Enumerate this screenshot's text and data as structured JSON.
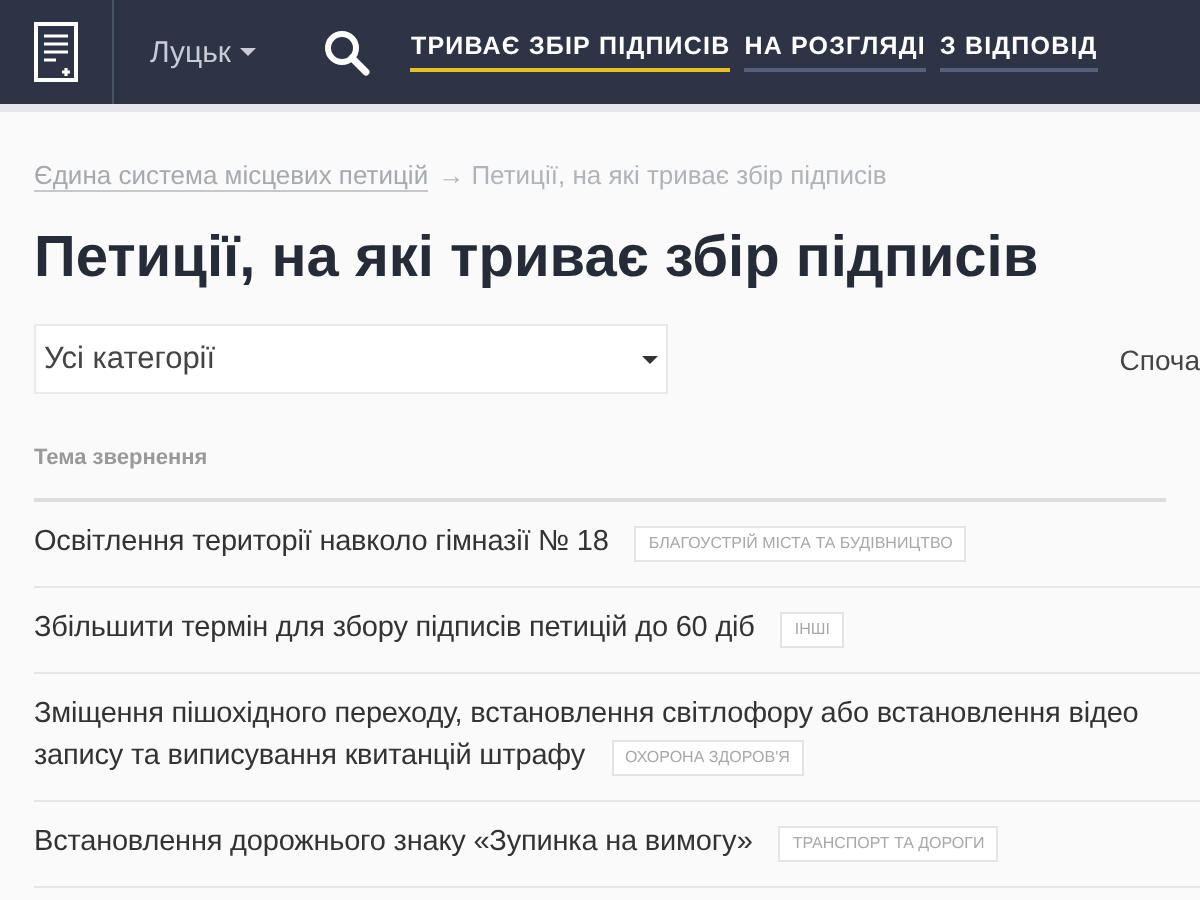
{
  "header": {
    "city": "Луцьк",
    "tabs": [
      {
        "label": "ТРИВАЄ ЗБІР ПІДПИСІВ",
        "selected": true
      },
      {
        "label": "НА РОЗГЛЯДІ",
        "selected": false
      },
      {
        "label": "З ВІДПОВІД",
        "selected": false
      }
    ]
  },
  "breadcrumb": {
    "link": "Єдина система місцевих петицій",
    "current": "→ Петиції, на які триває збір підписів"
  },
  "title": "Петиції, на які триває збір підписів",
  "category_select": {
    "value": "Усі категорії"
  },
  "sort_label": "Споча",
  "table": {
    "column": "Тема звернення",
    "rows": [
      {
        "lines": [
          "Освітлення території навколо гімназії № 18"
        ],
        "tag": "БЛАГОУСТРІЙ МІСТА ТА БУДІВНИЦТВО"
      },
      {
        "lines": [
          "Збільшити термін для збору підписів петицій до 60 діб"
        ],
        "tag": "ІНШІ"
      },
      {
        "lines": [
          "Зміщення пішохідного переходу, встановлення світлофору або встановлення відео",
          "запису та виписування квитанцій штрафу"
        ],
        "tag": "ОХОРОНА ЗДОРОВ'Я"
      },
      {
        "lines": [
          "Встановлення дорожнього знаку «Зупинка на вимогу»"
        ],
        "tag": "ТРАНСПОРТ ТА ДОРОГИ"
      }
    ]
  }
}
